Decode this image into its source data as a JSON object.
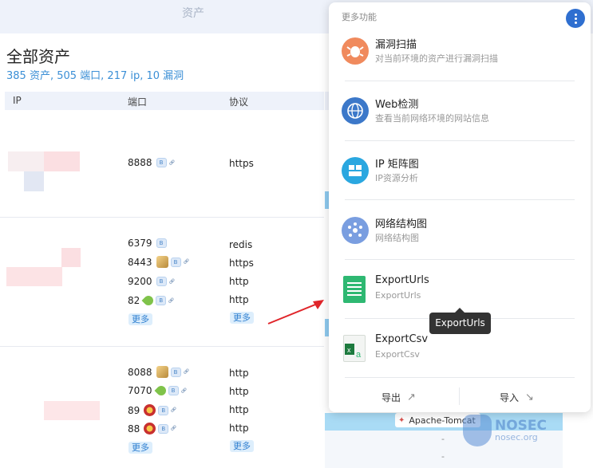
{
  "header": {
    "title": "资产"
  },
  "page": {
    "title": "全部资产",
    "summary": "385 资产, 505 端口, 217 ip, 10 漏洞"
  },
  "table": {
    "columns": [
      "IP",
      "端口",
      "协议"
    ],
    "groups": [
      {
        "ports": [
          {
            "port": "8888",
            "protocol": "https",
            "service_icon": "",
            "has_link": true
          }
        ]
      },
      {
        "ports": [
          {
            "port": "6379",
            "protocol": "redis",
            "service_icon": "",
            "has_link": false
          },
          {
            "port": "8443",
            "protocol": "https",
            "service_icon": "tomcat-icon",
            "has_link": true
          },
          {
            "port": "9200",
            "protocol": "http",
            "service_icon": "",
            "has_link": true
          },
          {
            "port": "82",
            "protocol": "http",
            "service_icon": "leaf-icon",
            "has_link": true
          }
        ],
        "more": "更多",
        "protocol_more": "更多"
      },
      {
        "ports": [
          {
            "port": "8088",
            "protocol": "http",
            "service_icon": "tomcat-icon",
            "has_link": true
          },
          {
            "port": "7070",
            "protocol": "http",
            "service_icon": "leaf-icon",
            "has_link": true
          },
          {
            "port": "89",
            "protocol": "http",
            "service_icon": "gov-emblem-icon",
            "has_link": true
          },
          {
            "port": "88",
            "protocol": "http",
            "service_icon": "gov-emblem-icon",
            "has_link": true
          }
        ],
        "more": "更多",
        "protocol_more": "更多"
      }
    ],
    "background_chip": "Apache-Tomcat",
    "dash": "-"
  },
  "menu": {
    "title": "更多功能",
    "items": [
      {
        "name": "漏洞扫描",
        "desc": "对当前环境的资产进行漏洞扫描",
        "icon": "bug-icon",
        "color": "#f08a5d"
      },
      {
        "name": "Web检测",
        "desc": "查看当前网络环境的网站信息",
        "icon": "globe-icon",
        "color": "#3c78c9"
      },
      {
        "name": "IP 矩阵图",
        "desc": "IP资源分析",
        "icon": "matrix-icon",
        "color": "#2aa7e0"
      },
      {
        "name": "网络结构图",
        "desc": "网络结构图",
        "icon": "network-icon",
        "color": "#7a9ee0"
      },
      {
        "name": "ExportUrls",
        "desc": "ExportUrls",
        "icon": "document-green-icon",
        "color": "#2eb872"
      },
      {
        "name": "ExportCsv",
        "desc": "ExportCsv",
        "icon": "excel-icon",
        "color": "#1d7a3e"
      }
    ],
    "export_label": "导出",
    "import_label": "导入"
  },
  "tooltip": "ExportUrls",
  "watermark": {
    "brand": "NOSEC",
    "domain": "nosec.org"
  }
}
